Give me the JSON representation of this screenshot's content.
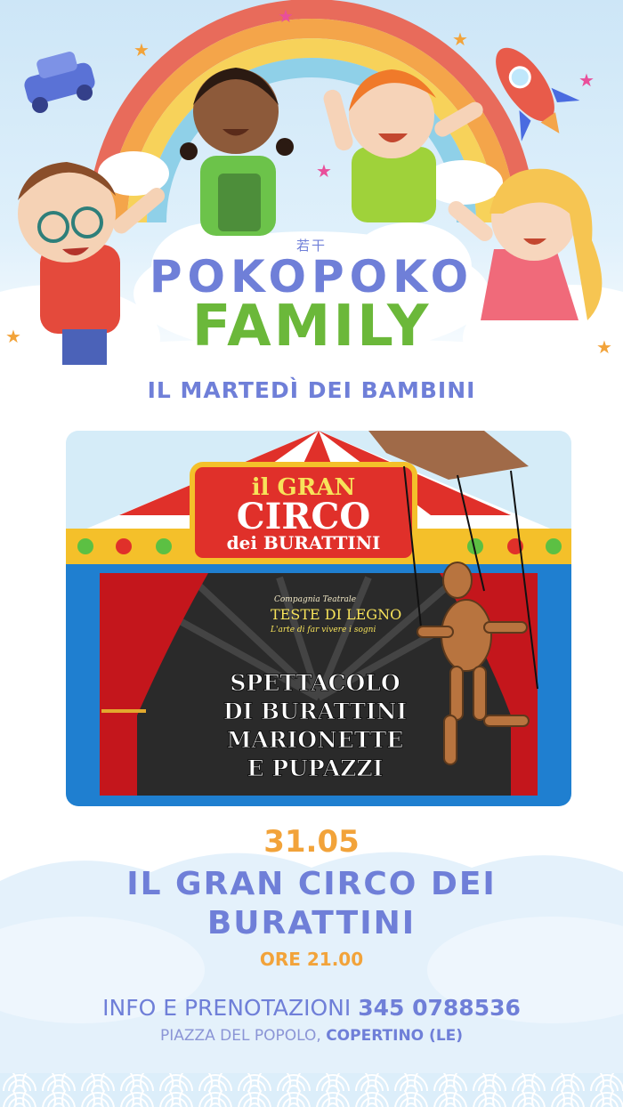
{
  "header": {
    "kanji": "若干",
    "brand_line1": "POKOPOKO",
    "brand_line2": "FAMILY",
    "subtitle": "IL MARTEDÌ DEI BAMBINI"
  },
  "poster": {
    "banner_line1": "il GRAN",
    "banner_line2": "CIRCO",
    "banner_line3": "dei BURATTINI",
    "company_small": "Compagnia Teatrale",
    "company_name": "TESTE DI LEGNO",
    "company_tagline": "L'arte di far vivere i sogni",
    "show_line1": "SPETTACOLO",
    "show_line2": "DI BURATTINI",
    "show_line3": "MARIONETTE",
    "show_line4": "E PUPAZZI"
  },
  "event": {
    "date": "31.05",
    "title": "IL GRAN CIRCO DEI BURATTINI",
    "time": "ORE 21.00"
  },
  "contact": {
    "info_label": "INFO E PRENOTAZIONI",
    "phone": "345 0788536",
    "address_label": "PIAZZA DEL POPOLO,",
    "city": "COPERTINO (LE)"
  },
  "colors": {
    "brand_blue": "#6f7fd8",
    "brand_green": "#6bb83a",
    "accent_orange": "#f2a33a",
    "sky": "#cde6f7"
  }
}
